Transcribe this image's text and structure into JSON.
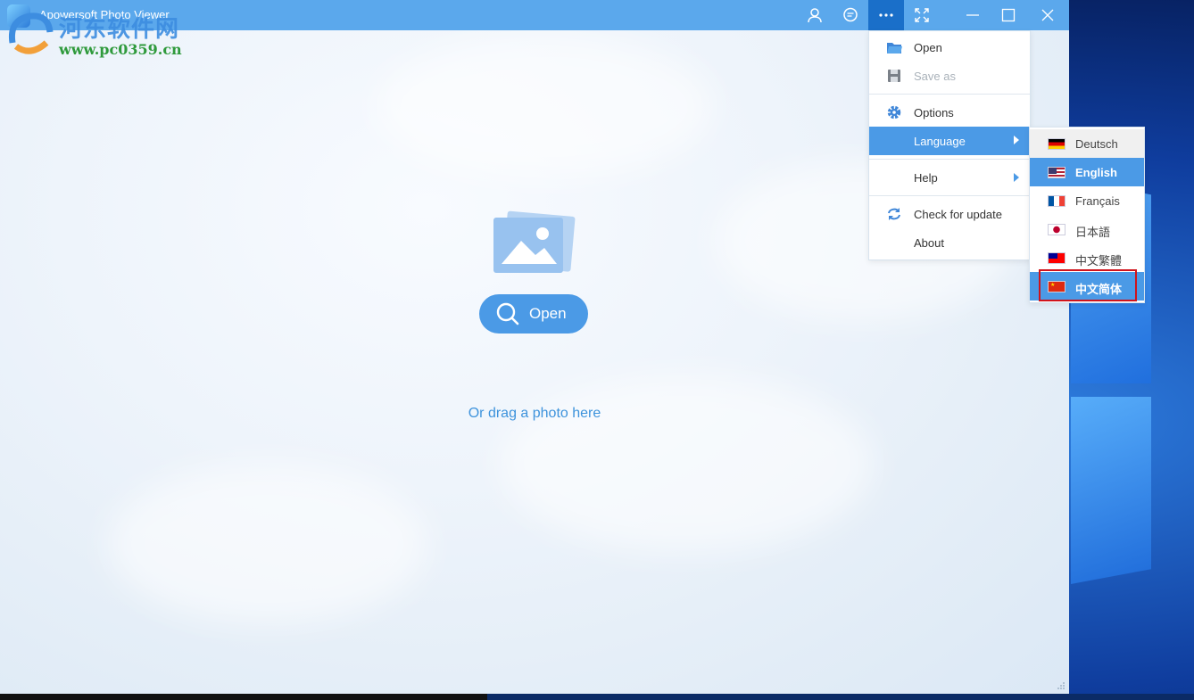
{
  "window": {
    "title": "Apowersoft Photo Viewer",
    "watermark_text": "河东软件网",
    "watermark_url": "www.pc0359.cn"
  },
  "titlebar": {
    "icons": [
      "user-icon",
      "feedback-icon",
      "more-icon",
      "fullscreen-icon",
      "minimize-icon",
      "maximize-icon",
      "close-icon"
    ]
  },
  "main": {
    "open_label": "Open",
    "drag_hint": "Or drag a photo here"
  },
  "menu": {
    "items": [
      {
        "label": "Open",
        "icon": "folder-icon",
        "enabled": true
      },
      {
        "label": "Save as",
        "icon": "save-icon",
        "enabled": false
      },
      {
        "label": "Options",
        "icon": "gear-icon",
        "enabled": true
      },
      {
        "label": "Language",
        "icon": "",
        "enabled": true,
        "submenu": true,
        "active": true
      },
      {
        "label": "Help",
        "icon": "",
        "enabled": true,
        "submenu": true
      },
      {
        "label": "Check for update",
        "icon": "refresh-icon",
        "enabled": true
      },
      {
        "label": "About",
        "icon": "",
        "enabled": true
      }
    ]
  },
  "language_menu": {
    "items": [
      {
        "label": "Deutsch",
        "flag": "germany-flag"
      },
      {
        "label": "English",
        "flag": "usa-flag",
        "selected": true
      },
      {
        "label": "Français",
        "flag": "france-flag"
      },
      {
        "label": "日本語",
        "flag": "japan-flag"
      },
      {
        "label": "中文繁體",
        "flag": "taiwan-flag"
      },
      {
        "label": "中文简体",
        "flag": "china-flag",
        "highlighted": true
      }
    ]
  },
  "colors": {
    "titlebar": "#5ba8ec",
    "accent": "#4b9ae6",
    "highlight_box": "#d0131b"
  }
}
